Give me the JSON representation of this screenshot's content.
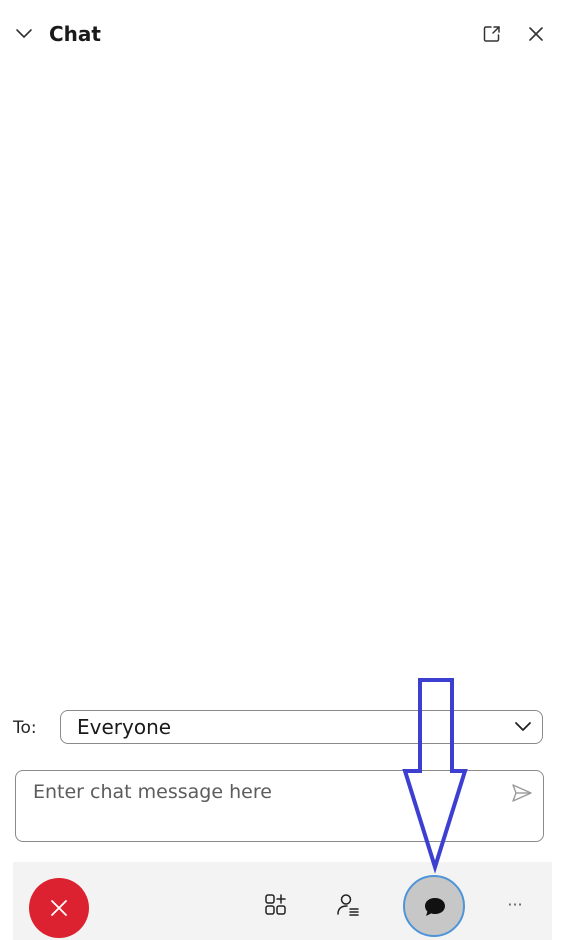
{
  "header": {
    "title": "Chat",
    "collapse_icon": "chevron-down-icon",
    "popout_icon": "popout-icon",
    "close_icon": "close-icon"
  },
  "recipient": {
    "label": "To:",
    "selected": "Everyone"
  },
  "message": {
    "placeholder": "Enter chat message here",
    "value": "",
    "send_icon": "send-icon"
  },
  "toolbar": {
    "end_call_icon": "close-icon",
    "apps_icon": "add-apps-icon",
    "participants_icon": "participants-icon",
    "chat_icon": "chat-bubble-icon",
    "more_label": "···"
  },
  "colors": {
    "end_call": "#dc2230",
    "active_chat_bg": "#c7c7c7",
    "active_chat_ring": "#4f94d8",
    "toolbar_bg": "#f3f3f3",
    "annotation_arrow": "#3c3fd0"
  }
}
